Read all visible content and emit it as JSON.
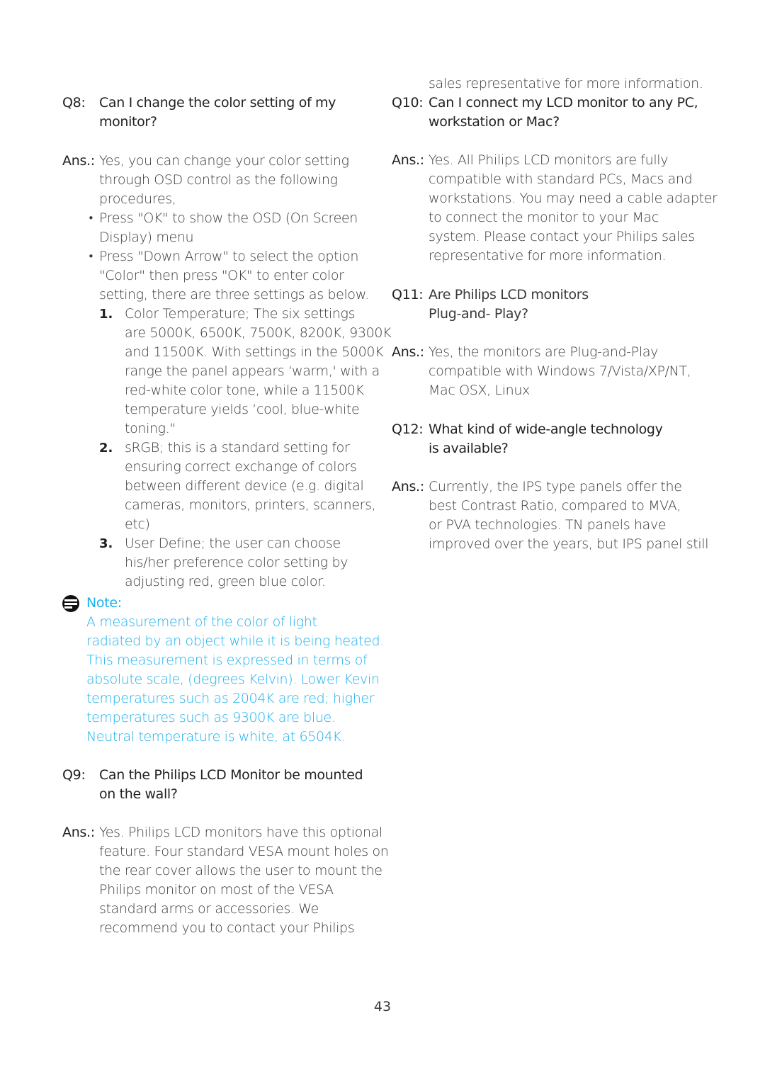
{
  "page_number": "43",
  "accent_color": "#1ab0ee",
  "left_column": {
    "q8": {
      "label": "Q8:",
      "question_lines": [
        "Can I change the color setting of my",
        "monitor?"
      ],
      "answer_label": "Ans.:",
      "answer_lines": [
        "Yes, you can change your color setting",
        "through OSD control as the following",
        "procedures,"
      ],
      "bullets": [
        {
          "marker": "•",
          "lines": [
            "Press \"OK\" to show the OSD (On Screen",
            "Display) menu"
          ]
        },
        {
          "marker": "•",
          "lines": [
            "Press \"Down Arrow\" to select the option",
            "\"Color\" then press \"OK\" to enter color",
            "setting, there are three settings as below."
          ]
        }
      ],
      "numbered": [
        {
          "marker": "1.",
          "lines": [
            "Color Temperature; The six settings",
            "are 5000K, 6500K, 7500K, 8200K, 9300K",
            "and 11500K. With settings in the 5000K",
            "range the panel appears ‘warm,' with a",
            "red-white color tone, while a 11500K",
            "temperature yields ‘cool, blue-white",
            "toning.\""
          ]
        },
        {
          "marker": "2.",
          "lines": [
            "sRGB; this is a standard setting for",
            "ensuring correct exchange of colors",
            "between different device (e.g. digital",
            "cameras, monitors, printers, scanners,",
            "etc)"
          ]
        },
        {
          "marker": "3.",
          "lines": [
            "User Define; the user can choose",
            "his/her preference color setting by",
            "adjusting red, green blue color."
          ]
        }
      ]
    },
    "note": {
      "icon": "note-icon",
      "title": "Note:",
      "lines": [
        "A measurement of the color of light",
        "radiated by an object while it is being heated.",
        "This measurement is expressed in terms of",
        "absolute scale, (degrees Kelvin). Lower Kevin",
        "temperatures such as 2004K are red; higher",
        "temperatures such as 9300K are blue.",
        "Neutral temperature is white, at 6504K."
      ]
    },
    "q9": {
      "label": "Q9:",
      "question_lines": [
        "Can the Philips LCD Monitor be  mounted",
        "on the wall?"
      ],
      "answer_label": "Ans.:",
      "answer_lines": [
        "Yes. Philips LCD monitors have this optional",
        "feature. Four standard VESA mount holes on",
        "the rear cover allows the user to mount the",
        "Philips monitor on most of the VESA",
        "standard arms or accessories. We",
        "recommend you to contact your Philips"
      ]
    }
  },
  "right_column": {
    "continuation_line": "sales representative for more information.",
    "q10": {
      "label": "Q10:",
      "question_lines": [
        "Can I connect my LCD monitor to any PC,",
        "workstation or Mac?"
      ],
      "answer_label": "Ans.:",
      "answer_lines": [
        "Yes. All Philips LCD monitors are fully",
        "compatible with standard PCs, Macs and",
        "workstations. You may need a cable adapter",
        "to connect the monitor to your Mac",
        "system. Please contact your Philips sales",
        "representative for more information."
      ]
    },
    "q11": {
      "label": "Q11:",
      "question_lines": [
        "Are Philips LCD monitors",
        "Plug-and- Play?"
      ],
      "answer_label": "Ans.:",
      "answer_lines": [
        "Yes, the monitors are Plug-and-Play",
        "compatible with Windows 7/Vista/XP/NT,",
        "Mac OSX, Linux"
      ]
    },
    "q12": {
      "label": "Q12:",
      "question_lines": [
        "What kind of wide-angle technology",
        "is available?"
      ],
      "answer_label": "Ans.:",
      "answer_lines": [
        "Currently, the IPS type panels offer the",
        "best Contrast Ratio, compared to MVA,",
        "or PVA technologies.  TN panels have",
        "improved over the years, but IPS panel still"
      ]
    }
  }
}
